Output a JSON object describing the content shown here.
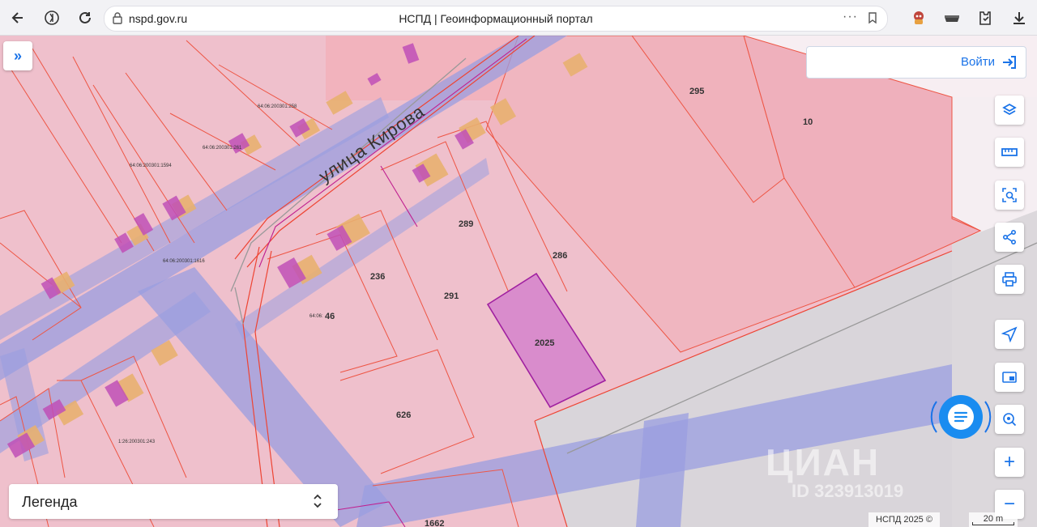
{
  "browser": {
    "url": "nspd.gov.ru",
    "tab_title": "НСПД | Геоинформационный портал",
    "more_label": "···"
  },
  "map": {
    "street_label": "улица  Кирова",
    "parcel_labels": [
      "295",
      "10",
      "289",
      "286",
      "236",
      "291",
      "46",
      "2025",
      "626",
      "1662"
    ],
    "cadastral_labels": [
      "64:06:200301:258",
      "64:06:200301:261",
      "64:06:200301:1594",
      "64:06:200301:1616",
      "64:06:",
      "1:26:200301:243"
    ],
    "highlighted_parcel": "2025",
    "watermark": {
      "brand": "ЦИАН",
      "id": "ID 323913019"
    },
    "copyright": "НСПД 2025 ©",
    "scale": "20 m"
  },
  "ui": {
    "login_label": "Войти",
    "legend_label": "Легенда",
    "expand_label": "»",
    "zoom_in": "+",
    "zoom_out": "−"
  },
  "colors": {
    "parcel_fill": "#f0b8c4",
    "parcel_stroke": "#ee5544",
    "road_band": "#9a9ee0",
    "highlight_fill": "#d98ccc",
    "highlight_stroke": "#a020a0",
    "building_orange": "#e8b070",
    "building_magenta": "#c050b8",
    "accent": "#1a73e8"
  }
}
